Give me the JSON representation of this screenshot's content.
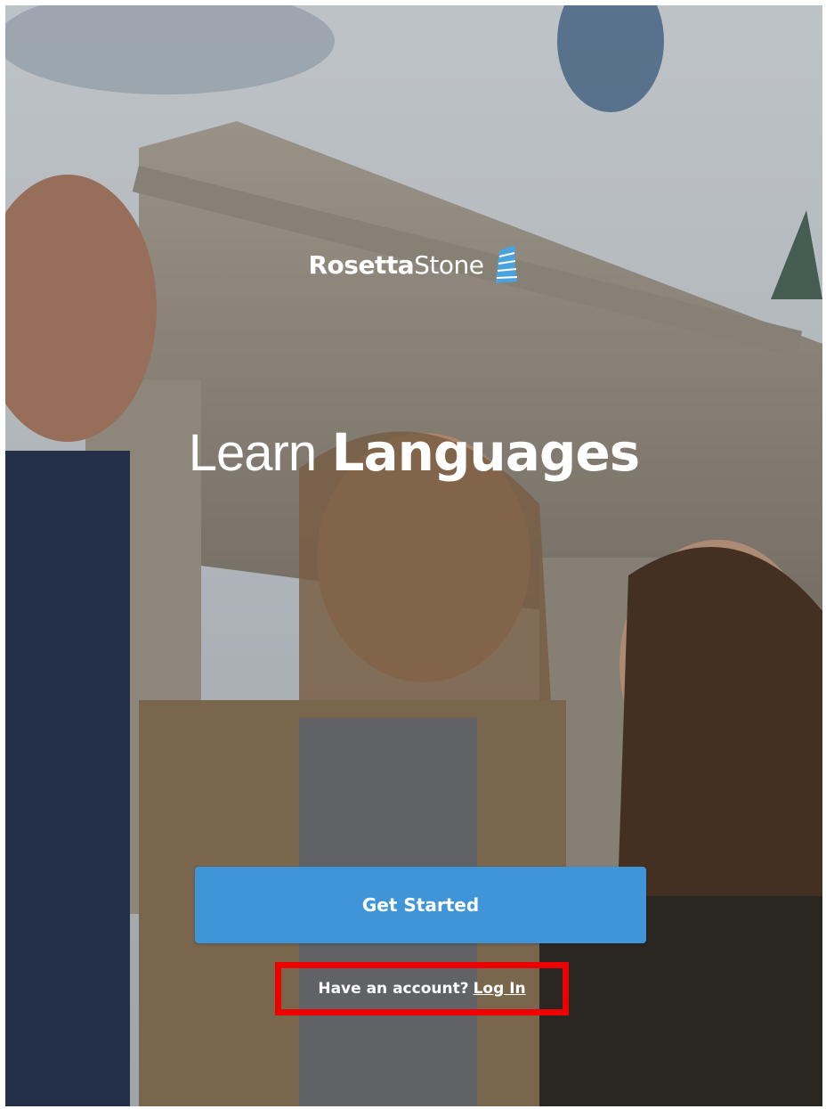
{
  "brand": {
    "name_bold": "Rosetta",
    "name_light": "Stone",
    "logo_icon": "sail-icon",
    "accent": "#3f95d8"
  },
  "headline": {
    "light": "Learn",
    "bold": "Languages"
  },
  "actions": {
    "get_started_label": "Get Started",
    "have_account_text": "Have an account?",
    "login_label": "Log In"
  },
  "highlight": {
    "color": "#ee0000"
  }
}
